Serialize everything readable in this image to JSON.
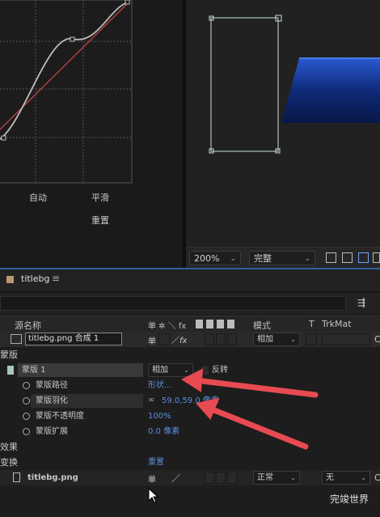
{
  "graph": {
    "btn_auto": "自动",
    "btn_smooth": "平滑",
    "btn_reset": "重置"
  },
  "comp_toolbar": {
    "zoom": "200%",
    "resolution": "完整"
  },
  "timeline": {
    "tab_name": "titlebg",
    "columns": {
      "source_name": "源名称",
      "switches": "单 ✲ ＼ fx",
      "mode": "模式",
      "t": "T",
      "trkmat": "TrkMat"
    },
    "layer1": {
      "name": "titlebg.png 合成 1",
      "mode": "相加",
      "trkmat_suffix": "C"
    },
    "mask_group_label": "蒙版",
    "mask1": {
      "name": "蒙版 1",
      "mode": "相加",
      "inverted_label": "反转"
    },
    "mask_path": {
      "label": "蒙版路径",
      "value": "形状..."
    },
    "mask_feather": {
      "label": "蒙版羽化",
      "value": "59.0,59.0 像素"
    },
    "mask_opacity": {
      "label": "蒙版不透明度",
      "value": "100%"
    },
    "mask_expansion": {
      "label": "蒙版扩展",
      "value": "0.0 像素"
    },
    "effects_label": "效果",
    "transform_label": "变换",
    "transform_reset": "重置",
    "layer2": {
      "name": "titlebg.png",
      "mode": "正常",
      "trkmat": "无",
      "trkmat_suffix": "C"
    }
  },
  "watermark": "完竣世界",
  "colors": {
    "accent_blue": "#5a8fd8",
    "arrow_red": "#e84a52",
    "tab_divider_blue": "#2f5fa0"
  }
}
